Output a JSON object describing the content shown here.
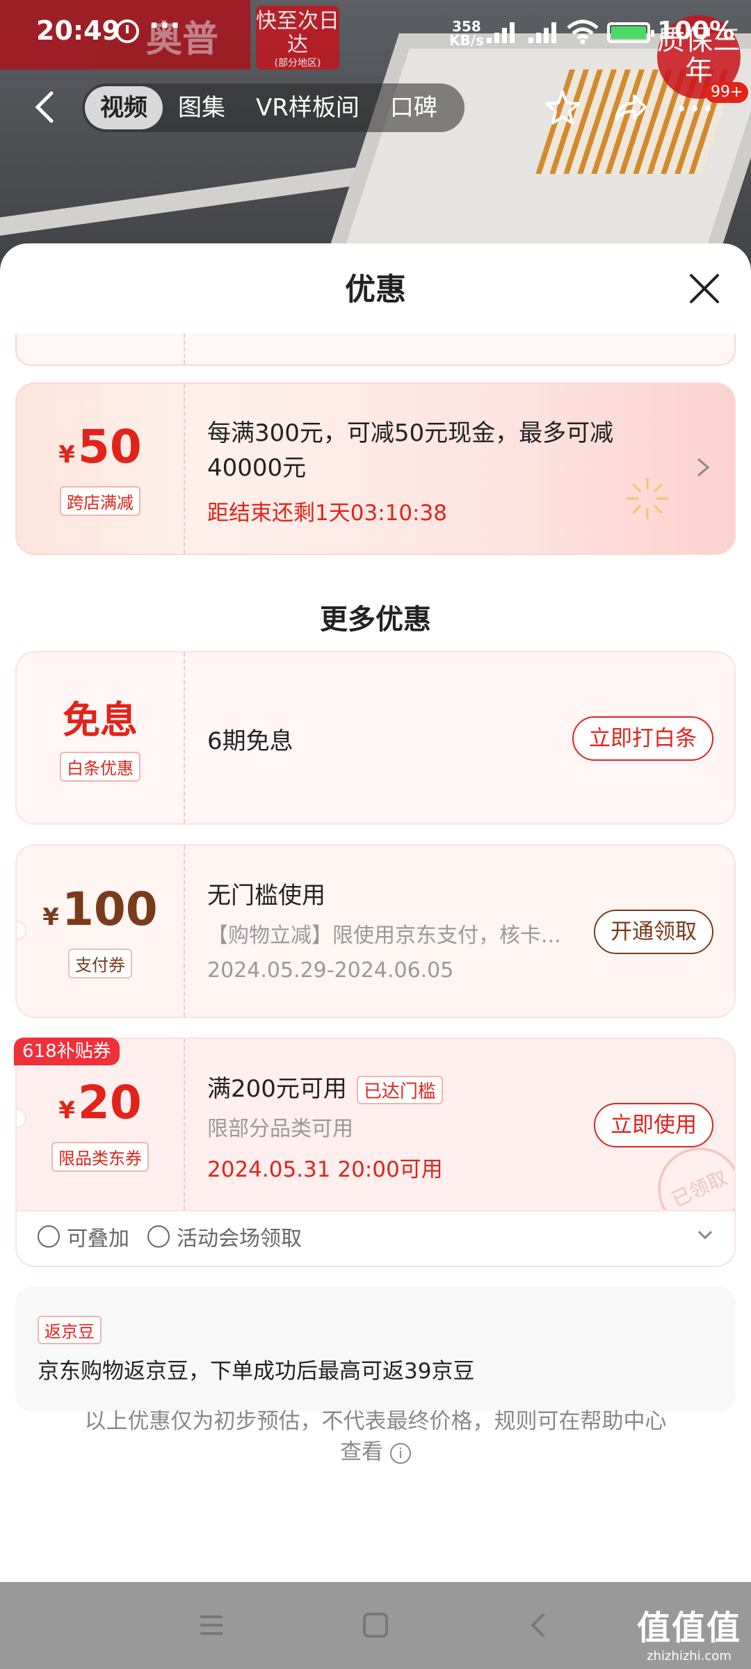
{
  "status_bar": {
    "time": "20:49",
    "more": "···",
    "net_speed_value": "358",
    "net_speed_unit": "KB/s",
    "battery": "100%"
  },
  "background": {
    "brand": "奥普",
    "fast_tag": "快至次日达",
    "fast_tag_note": "(部分地区)",
    "warranty": "质保三年"
  },
  "nav": {
    "tabs": [
      "视频",
      "图集",
      "VR样板间",
      "口碑"
    ],
    "active_tab": 0,
    "badge": "99+"
  },
  "sheet": {
    "title": "优惠",
    "coupon_top": {
      "amount": "50",
      "currency": "¥",
      "tag": "跨店满减",
      "description": "每满300元，可减50元现金，最多可减40000元",
      "countdown": "距结束还剩1天03:10:38"
    },
    "more_title": "更多优惠",
    "interest_free": {
      "title": "免息",
      "tag": "白条优惠",
      "description": "6期免息",
      "button": "立即打白条"
    },
    "pay_coupon": {
      "currency": "¥",
      "amount": "100",
      "tag": "支付券",
      "title": "无门槛使用",
      "desc": "【购物立减】限使用京东支付，核卡...",
      "period": "2024.05.29-2024.06.05",
      "button": "开通领取"
    },
    "category_coupon": {
      "ribbon": "618补贴券",
      "currency": "¥",
      "amount": "20",
      "tag": "限品类东券",
      "title": "满200元可用",
      "reached": "已达门槛",
      "desc": "限部分品类可用",
      "time": "2024.05.31 20:00可用",
      "button": "立即使用",
      "stamp": "已领取",
      "stackable": "可叠加",
      "venue": "活动会场领取"
    },
    "beans": {
      "tag": "返京豆",
      "text": "京东购物返京豆，下单成功后最高可返39京豆"
    },
    "footnote": "以上优惠仅为初步预估，不代表最终价格，规则可在帮助中心查看"
  },
  "watermark": {
    "line1": "值值值",
    "line2": "zhizhizhi.com"
  },
  "colors": {
    "accent_red": "#e2231a",
    "brown": "#7a3b1b"
  }
}
